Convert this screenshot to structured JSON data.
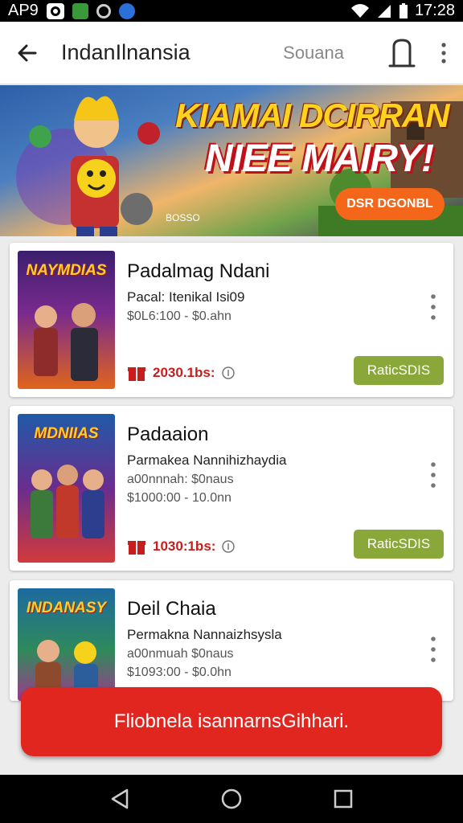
{
  "status_bar": {
    "carrier": "AP9",
    "time": "17:28"
  },
  "app_bar": {
    "title": "IndanIlnansia",
    "subtitle": "Souana"
  },
  "banner": {
    "headline_line1": "KIAMAI DCIRRAN",
    "headline_line2": "NIEE MAIRY!",
    "button_label": "DSR DGONBL",
    "caption": "BOSSO"
  },
  "items": [
    {
      "thumb_title": "NAYMDIAS",
      "name": "Padalmag Ndani",
      "line1": "Pacal: Itenikal Isi09",
      "line2": "$0L6:100 - $0.ahn",
      "line3": "",
      "price": "2030.1bs:",
      "action_label": "RaticSDIS"
    },
    {
      "thumb_title": "MDNIIAS",
      "name": "Padaaion",
      "line1": "Parmakea Nannihizhaydia",
      "line2": "a00nnnah: $0naus",
      "line3": "$1000:00 - 10.0nn",
      "price": "1030:1bs:",
      "action_label": "RaticSDIS"
    },
    {
      "thumb_title": "INDANASY",
      "name": "Deil Chaia",
      "line1": "Permakna Nannaizhsysla",
      "line2": "a00nmuah $0naus",
      "line3": "$1093:00 - $0.0hn",
      "price": "",
      "action_label": ""
    }
  ],
  "toast": {
    "message": "Fliobnela isannarnsGihhari."
  },
  "colors": {
    "accent_red": "#e0261f",
    "action_green": "#8aa83a",
    "banner_orange": "#f4671b"
  }
}
